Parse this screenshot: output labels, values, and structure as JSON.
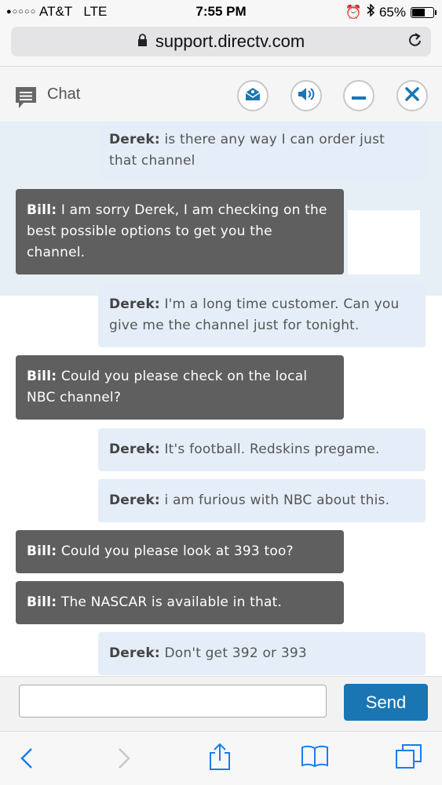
{
  "status": {
    "carrier": "AT&T",
    "network": "LTE",
    "time": "7:55 PM",
    "battery": "65%",
    "battery_level": 0.65
  },
  "browser": {
    "url": "support.directv.com"
  },
  "chat": {
    "title": "Chat",
    "buttons": [
      "email-icon",
      "speaker-icon",
      "minimize-icon",
      "close-icon"
    ]
  },
  "messages": [
    {
      "role": "customer",
      "sender": "Derek:",
      "text": "is there any way I can order just that channel"
    },
    {
      "role": "agent",
      "sender": "Bill:",
      "text": "I am sorry Derek, I am checking on the best possible options to get you the channel."
    },
    {
      "role": "customer",
      "sender": "Derek:",
      "text": "I'm a long time customer. Can you give me the channel just for tonight."
    },
    {
      "role": "agent",
      "sender": "Bill:",
      "text": "Could you please check on the local NBC channel?"
    },
    {
      "role": "customer",
      "sender": "Derek:",
      "text": "It's football. Redskins pregame."
    },
    {
      "role": "customer",
      "sender": "Derek:",
      "text": "i am furious with NBC about this."
    },
    {
      "role": "agent",
      "sender": "Bill:",
      "text": "Could you please look at 393 too?"
    },
    {
      "role": "agent",
      "sender": "Bill:",
      "text": "The NASCAR is available in that."
    },
    {
      "role": "customer",
      "sender": "Derek:",
      "text": "Don't get 392 or 393"
    }
  ],
  "input": {
    "value": "",
    "send_label": "Send"
  }
}
